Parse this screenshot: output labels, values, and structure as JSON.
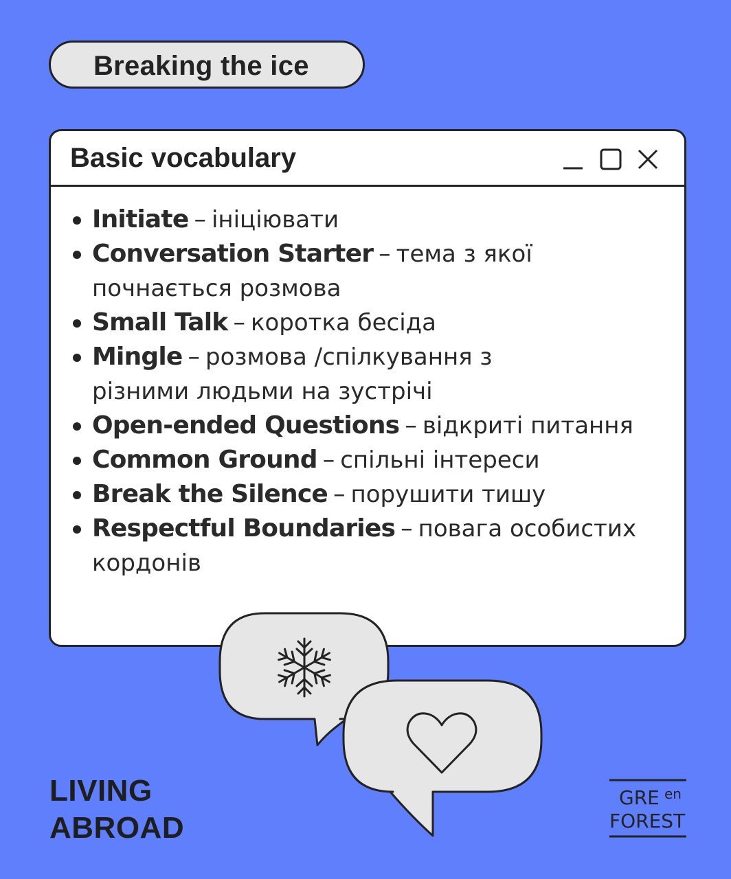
{
  "header": {
    "pill_label": "Breaking the ice"
  },
  "window": {
    "title": "Basic vocabulary",
    "controls": {
      "minimize": "minimize-icon",
      "maximize": "maximize-icon",
      "close": "close-icon"
    },
    "items": [
      {
        "term": "Initiate",
        "translation": "ініціювати"
      },
      {
        "term": "Conversation Starter",
        "translation": "тема з якої почнається розмова"
      },
      {
        "term": "Small Talk",
        "translation": "коротка бесіда"
      },
      {
        "term": "Mingle",
        "translation": "розмова /спілкування з різними людьми на зустрічі"
      },
      {
        "term": "Open-ended Questions",
        "translation": "відкриті питання"
      },
      {
        "term": "Common Ground",
        "translation": "спільні інтереси"
      },
      {
        "term": "Break the Silence",
        "translation": "порушити тишу"
      },
      {
        "term": "Respectful Boundaries",
        "translation": "повага особистих кордонів"
      }
    ],
    "dash": "–"
  },
  "icons": {
    "bubble_top": "snowflake-icon",
    "bubble_bottom": "heart-icon"
  },
  "footer": {
    "brand_line1": "LIVING",
    "brand_line2": "ABROAD",
    "logo": {
      "line1_main": "GRE",
      "line1_sup": "en",
      "line2": "FOREST"
    }
  },
  "colors": {
    "background": "#5f7ffd",
    "pill": "#e6e6e6",
    "window": "#ffffff",
    "bubble": "#e6e6e6",
    "ink": "#232323"
  }
}
